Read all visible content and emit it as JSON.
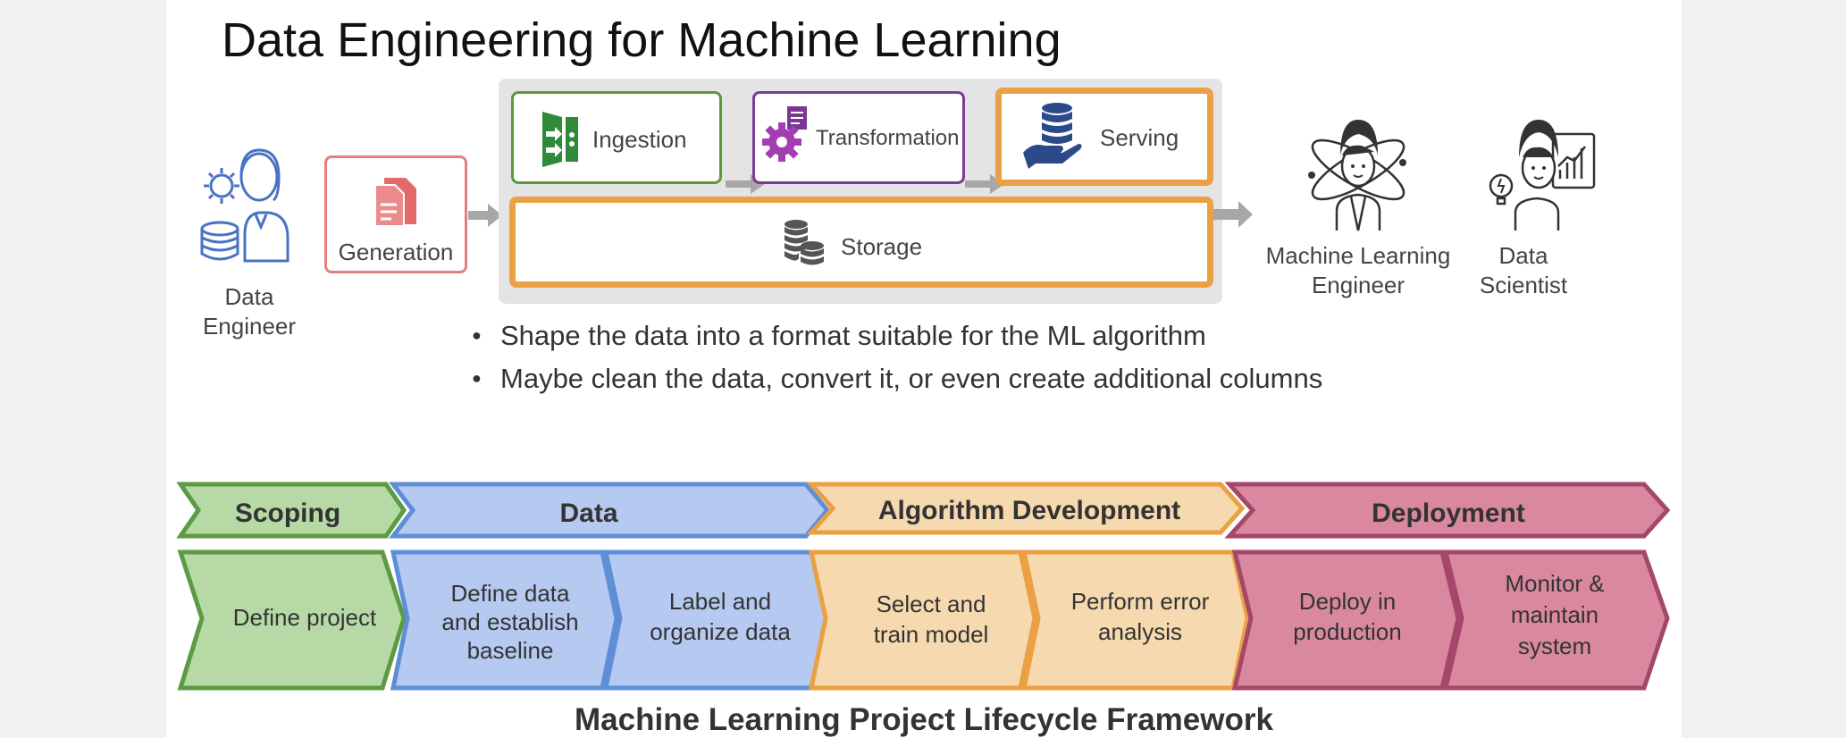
{
  "title": "Data Engineering for Machine Learning",
  "roles": {
    "data_engineer": [
      "Data",
      "Engineer"
    ],
    "ml_engineer": [
      "Machine Learning",
      "Engineer"
    ],
    "data_scientist": [
      "Data",
      "Scientist"
    ]
  },
  "stages": {
    "generation": "Generation",
    "ingestion": "Ingestion",
    "transformation": "Transformation",
    "serving": "Serving",
    "storage": "Storage"
  },
  "bullets": [
    "Shape the data into a format suitable for the ML algorithm",
    "Maybe clean the data, convert it, or even create additional columns"
  ],
  "colors": {
    "green": "#b7d9a6",
    "green_border": "#5c9a43",
    "blue": "#b5c9f1",
    "blue_border": "#5d8ed6",
    "orange": "#f6d9ae",
    "orange_border": "#eaa043",
    "pink": "#d9889f",
    "pink_border": "#a4476b",
    "generation_border": "#e77e7e",
    "ingestion_border": "#5b9a3a",
    "transformation_border": "#7c3b94"
  },
  "lifecycle": {
    "phases": [
      "Scoping",
      "Data",
      "Algorithm Development",
      "Deployment"
    ],
    "steps": [
      [
        "Define project"
      ],
      [
        "Define data",
        "and establish",
        "baseline"
      ],
      [
        "Label and",
        "organize data"
      ],
      [
        "Select and",
        "train model"
      ],
      [
        "Perform error",
        "analysis"
      ],
      [
        "Deploy in",
        "production"
      ],
      [
        "Monitor &",
        "maintain",
        "system"
      ]
    ],
    "caption": "Machine Learning Project Lifecycle Framework"
  }
}
